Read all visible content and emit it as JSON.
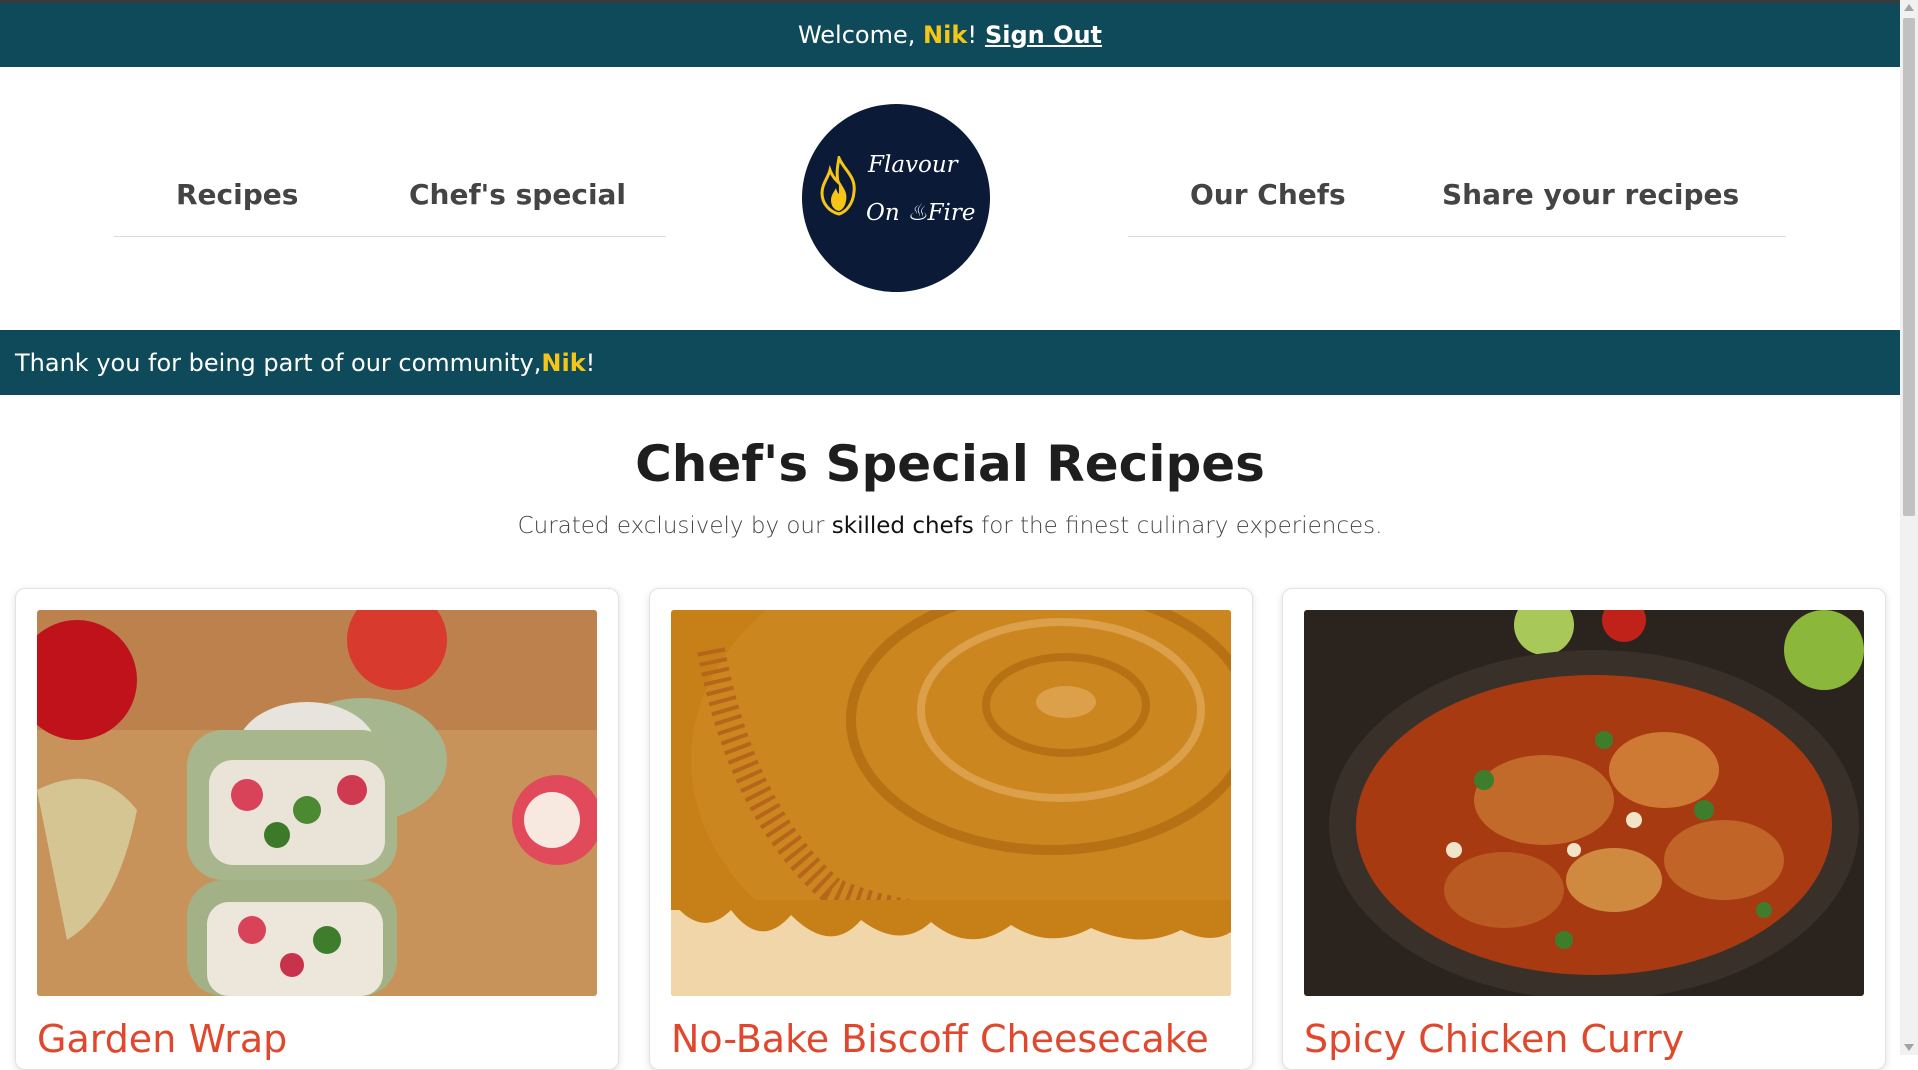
{
  "colors": {
    "bar": "#0e4a5a",
    "accent": "#f5c518",
    "recipe_title": "#e0482d",
    "logo_bg": "#0b1a37"
  },
  "welcome_bar": {
    "prefix": "Welcome, ",
    "name": "Nik",
    "suffix": "!",
    "signout": "Sign Out"
  },
  "nav": {
    "left": [
      {
        "label": "Recipes"
      },
      {
        "label": "Chef's special"
      }
    ],
    "right": [
      {
        "label": "Our Chefs"
      },
      {
        "label": "Share your recipes"
      }
    ]
  },
  "logo": {
    "line1": "Flavour",
    "line2": "On ♨Fire",
    "icon": "flame-icon"
  },
  "thanks_bar": {
    "prefix": "Thank you for being part of our community, ",
    "name": "Nik",
    "suffix": "!"
  },
  "section": {
    "title": "Chef's Special Recipes",
    "subtitle_prefix": "Curated exclusively by our ",
    "subtitle_highlight": "skilled chefs",
    "subtitle_suffix": " for the finest culinary experiences."
  },
  "recipes": [
    {
      "title": "Garden Wrap",
      "image": "garden-wrap-photo"
    },
    {
      "title": "No-Bake Biscoff Cheesecake",
      "image": "cheesecake-photo"
    },
    {
      "title": "Spicy Chicken Curry",
      "image": "curry-photo"
    }
  ]
}
